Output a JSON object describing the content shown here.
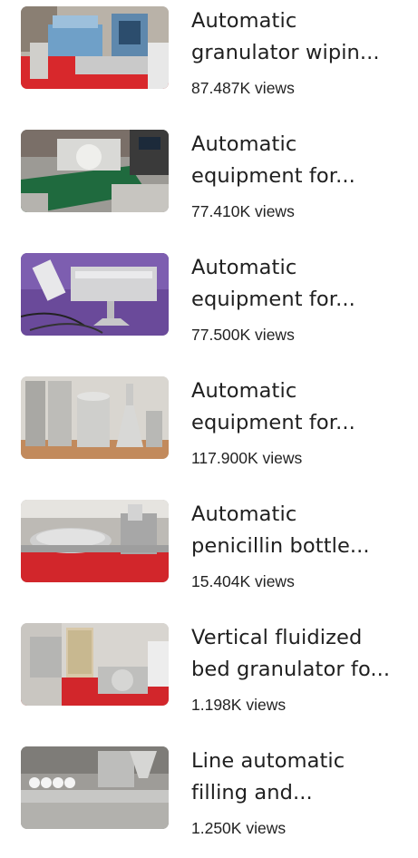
{
  "videos": [
    {
      "title_line1": "Automatic",
      "title_line2": "granulator wipin...",
      "views": "87.487K views",
      "thumbnail_icon": "granulator-machine-thumbnail"
    },
    {
      "title_line1": "Automatic",
      "title_line2": "equipment for...",
      "views": "77.410K views",
      "thumbnail_icon": "labeling-machine-thumbnail"
    },
    {
      "title_line1": "Automatic",
      "title_line2": "equipment for...",
      "views": "77.500K views",
      "thumbnail_icon": "uv-sterilizer-thumbnail"
    },
    {
      "title_line1": "Automatic",
      "title_line2": "equipment for...",
      "views": "117.900K views",
      "thumbnail_icon": "steel-filters-thumbnail"
    },
    {
      "title_line1": "Automatic",
      "title_line2": "penicillin bottle...",
      "views": "15.404K views",
      "thumbnail_icon": "bottle-filling-line-thumbnail"
    },
    {
      "title_line1": "Vertical fluidized",
      "title_line2": "bed granulator fo...",
      "views": "1.198K views",
      "thumbnail_icon": "fluidized-bed-thumbnail"
    },
    {
      "title_line1": "Line automatic",
      "title_line2": "filling and...",
      "views": "1.250K views",
      "thumbnail_icon": "filling-line-thumbnail"
    }
  ]
}
